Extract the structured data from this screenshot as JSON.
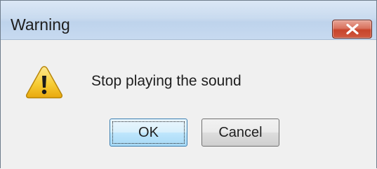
{
  "dialog": {
    "title": "Warning",
    "message": "Stop playing the sound",
    "icon": "warning-icon",
    "close_icon": "close-icon"
  },
  "buttons": {
    "ok_label": "OK",
    "cancel_label": "Cancel"
  },
  "colors": {
    "close_button": "#c7442b",
    "warning_icon_fill": "#f5c623",
    "default_button_border": "#3c7fb1"
  }
}
